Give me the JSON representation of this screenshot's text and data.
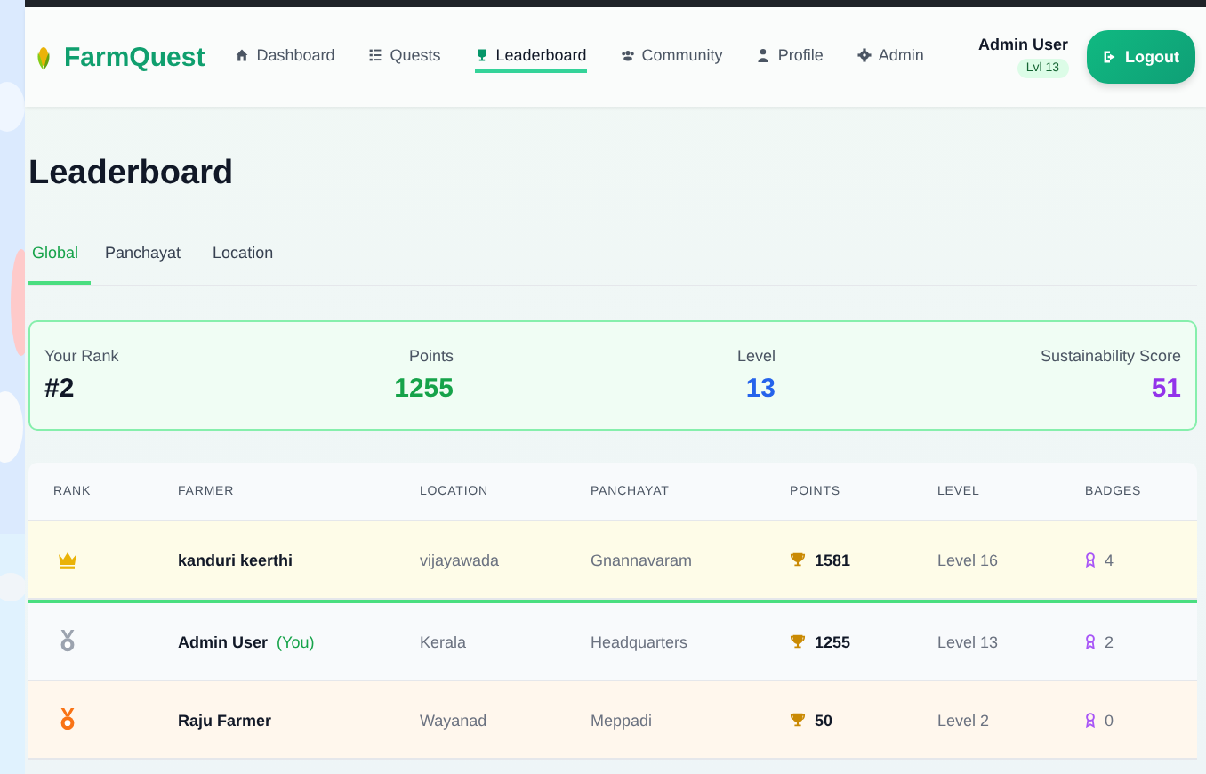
{
  "brand": "FarmQuest",
  "nav": [
    {
      "label": "Dashboard",
      "selected": false
    },
    {
      "label": "Quests",
      "selected": false
    },
    {
      "label": "Leaderboard",
      "selected": true
    },
    {
      "label": "Community",
      "selected": false
    },
    {
      "label": "Profile",
      "selected": false
    },
    {
      "label": "Admin",
      "selected": false
    }
  ],
  "user": {
    "name": "Admin User",
    "level_badge": "Lvl 13"
  },
  "logout": "Logout",
  "title": "Leaderboard",
  "tabs": [
    {
      "label": "Global",
      "selected": true
    },
    {
      "label": "Panchayat",
      "selected": false
    },
    {
      "label": "Location",
      "selected": false
    }
  ],
  "stats": [
    {
      "label": "Your Rank",
      "value": "#2",
      "color": "#111827"
    },
    {
      "label": "Points",
      "value": "1255",
      "color": "#16a34a"
    },
    {
      "label": "Level",
      "value": "13",
      "color": "#2563eb"
    },
    {
      "label": "Sustainability Score",
      "value": "51",
      "color": "#9333ea"
    }
  ],
  "table": {
    "columns": [
      "RANK",
      "FARMER",
      "LOCATION",
      "PANCHAYAT",
      "POINTS",
      "LEVEL",
      "BADGES"
    ],
    "rows": [
      {
        "kind": "gold",
        "farmer": "kanduri keerthi",
        "current_user": false,
        "location": "vijayawada",
        "panchayat": "Gnannavaram",
        "points": "1581",
        "level": "Level 16",
        "badges": "4"
      },
      {
        "kind": "silver",
        "farmer": "Admin User",
        "you_label": "(You)",
        "current_user": true,
        "location": "Kerala",
        "panchayat": "Headquarters",
        "points": "1255",
        "level": "Level 13",
        "badges": "2"
      },
      {
        "kind": "bronze",
        "farmer": "Raju Farmer",
        "current_user": false,
        "location": "Wayanad",
        "panchayat": "Meppadi",
        "points": "50",
        "level": "Level 2",
        "badges": "0"
      }
    ]
  }
}
